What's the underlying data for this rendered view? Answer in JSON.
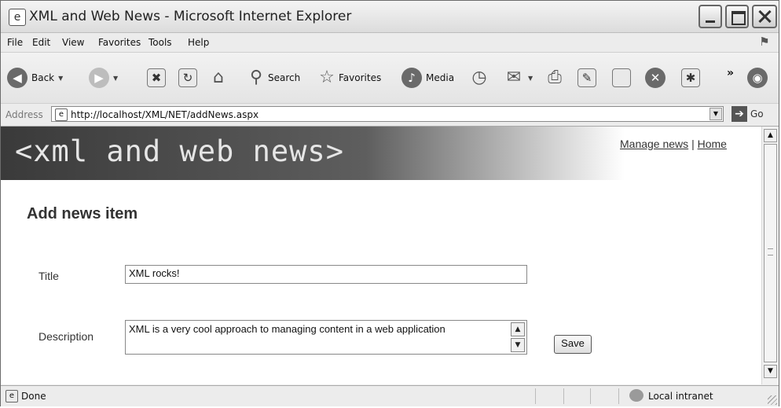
{
  "window": {
    "title": "XML and Web News - Microsoft Internet Explorer",
    "app_icon": "ie-logo-icon"
  },
  "menubar": {
    "items": [
      "File",
      "Edit",
      "View",
      "Favorites",
      "Tools",
      "Help"
    ]
  },
  "toolbar": {
    "back_label": "Back",
    "search_label": "Search",
    "favorites_label": "Favorites",
    "media_label": "Media",
    "more_glyph": "»"
  },
  "address": {
    "label": "Address",
    "url": "http://localhost/XML/NET/addNews.aspx",
    "go_label": "Go"
  },
  "page": {
    "banner_title": "<xml and web news>",
    "links": {
      "manage": "Manage news",
      "separator": "|",
      "home": "Home"
    },
    "heading": "Add news item",
    "form": {
      "title_label": "Title",
      "title_value": "XML rocks!",
      "description_label": "Description",
      "description_value": "XML is a very cool approach to managing content in a web application",
      "save_label": "Save"
    }
  },
  "status": {
    "text": "Done",
    "zone": "Local intranet"
  }
}
